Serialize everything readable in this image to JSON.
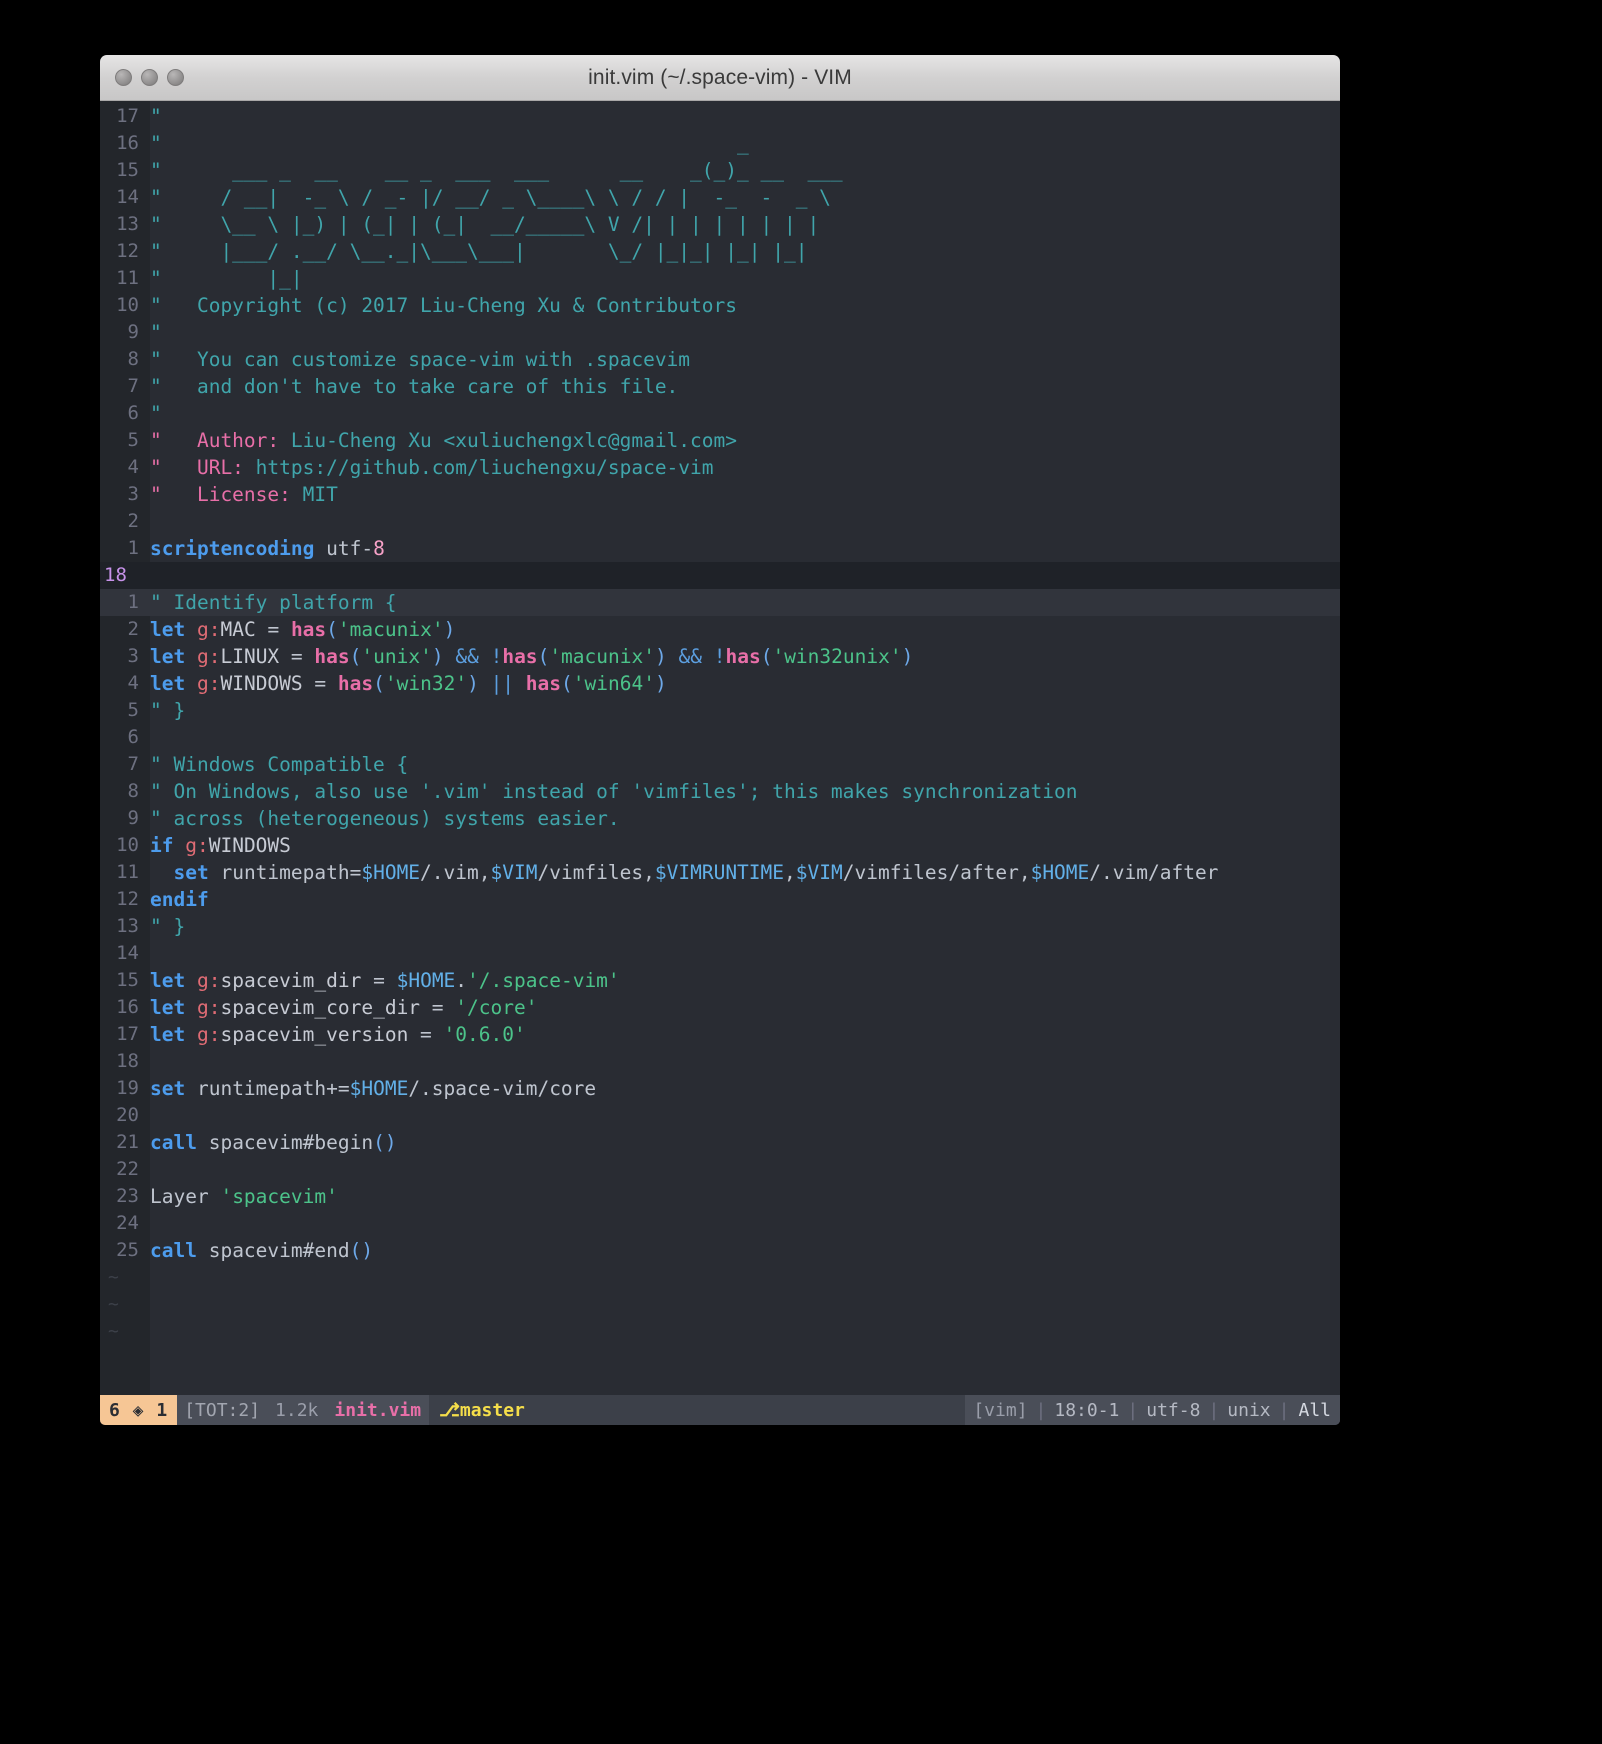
{
  "window": {
    "title": "init.vim (~/.space-vim) - VIM",
    "traffic_lights": [
      "close-button",
      "minimize-button",
      "maximize-button"
    ]
  },
  "theme": {
    "background": "#292c33",
    "gutter_background": "#23262b",
    "cursorline": "#31343c",
    "comment": "#40a5ab",
    "comment_keyword": "#e86fa8",
    "keyword": "#4d9ced",
    "function": "#e86fa8",
    "string": "#4cc38a",
    "number": "#f7a2c8",
    "variable": "#e06c75",
    "mode_accent": "#f6c695",
    "branch_accent": "#f5de4a",
    "cursor_number": "#c792ea"
  },
  "buffer_above": {
    "numbers": [
      "17",
      "16",
      "15",
      "14",
      "13",
      "12",
      "11",
      "10",
      "9",
      "8",
      "7",
      "6",
      "5",
      "4",
      "3",
      "2",
      "1"
    ],
    "lines": [
      {
        "n": "17",
        "tokens": [
          {
            "t": "\"",
            "c": "cmt"
          }
        ]
      },
      {
        "n": "16",
        "tokens": [
          {
            "t": "\"                                                    _",
            "c": "cmt"
          }
        ]
      },
      {
        "n": "15",
        "tokens": [
          {
            "t": "\"       ___ _  __    __ _  ___  ___      __    _(_)_ __  ___",
            "c": "cmt"
          }
        ]
      },
      {
        "n": "14",
        "tokens": [
          {
            "t": "\"      / __| -_ \\ / _- |/ __/ _ \\___\\ \\ / / | -_ - _ \\",
            "c": "cmt"
          }
        ]
      },
      {
        "n": "13",
        "tokens": [
          {
            "t": "\"      \\__ \\ |_) | (_| | (_|  __/____\\ V /| | | | | | | |",
            "c": "cmt"
          }
        ]
      },
      {
        "n": "12",
        "tokens": [
          {
            "t": "\"      |___/ .__/ \\__._|\\___\\___|      \\_/ |_|_| |_| |_|",
            "c": "cmt"
          }
        ]
      },
      {
        "n": "11",
        "tokens": [
          {
            "t": "\"          |_|",
            "c": "cmt"
          }
        ]
      },
      {
        "n": "10",
        "tokens": [
          {
            "t": "\"",
            "c": "cmt"
          }
        ]
      },
      {
        "n": "9",
        "tokens": [
          {
            "t": "\"   Copyright (c) 2017 Liu-Cheng Xu & Contributors",
            "c": "cmt"
          }
        ]
      },
      {
        "n": "8",
        "tokens": [
          {
            "t": "\"",
            "c": "cmt"
          }
        ]
      },
      {
        "n": "7",
        "tokens": [
          {
            "t": "\"   You can customize space-vim with .spacevim",
            "c": "cmt"
          }
        ]
      },
      {
        "n": "6",
        "tokens": [
          {
            "t": "\"   and don't have to take care of this file.",
            "c": "cmt"
          }
        ]
      }
    ]
  },
  "ascii_art": {
    "rows": [
      "\"                                                 _",
      "\"      ___ _  __    __ _  ___  ___      __    _(_)_ __  ___",
      "\"     / __|  -_ \\ / _- |/ __/ _ \\____\\ \\ / / |  -_  -  _ \\",
      "\"     \\__ \\ |_) | (_| | (_|  __/_____\\ V /| | | | | | | |",
      "\"     |___/ .__/ \\__._|\\___\\___|       \\_/ |_|_| |_| |_|",
      "\"         |_|"
    ]
  },
  "header_comments": {
    "copyright": "\"   Copyright (c) 2017 Liu-Cheng Xu & Contributors",
    "customize_1": "\"   You can customize space-vim with .spacevim",
    "customize_2": "\"   and don't have to take care of this file.",
    "author_label": "\"   Author:",
    "author_value": " Liu-Cheng Xu <xuliuchengxlc@gmail.com>",
    "url_label": "\"   URL:",
    "url_value": " https://github.com/liuchengxu/space-vim",
    "license_label": "\"   License:",
    "license_value": " MIT"
  },
  "code": {
    "scriptencoding_kw": "scriptencoding",
    "scriptencoding_val": " utf-",
    "scriptencoding_num": "8",
    "buffer_separator_number": "18",
    "lines": [
      {
        "n": "1",
        "text": "\" Identify platform {"
      },
      {
        "n": "2",
        "text": "let g:MAC = has('macunix')"
      },
      {
        "n": "3",
        "text": "let g:LINUX = has('unix') && !has('macunix') && !has('win32unix')"
      },
      {
        "n": "4",
        "text": "let g:WINDOWS = has('win32') || has('win64')"
      },
      {
        "n": "5",
        "text": "\" }"
      },
      {
        "n": "6",
        "text": ""
      },
      {
        "n": "7",
        "text": "\" Windows Compatible {"
      },
      {
        "n": "8",
        "text": "\" On Windows, also use '.vim' instead of 'vimfiles'; this makes synchronization"
      },
      {
        "n": "9",
        "text": "\" across (heterogeneous) systems easier."
      },
      {
        "n": "10",
        "text": "if g:WINDOWS"
      },
      {
        "n": "11",
        "text": "  set runtimepath=$HOME/.vim,$VIM/vimfiles,$VIMRUNTIME,$VIM/vimfiles/after,$HOME/.vim/after"
      },
      {
        "n": "12",
        "text": "endif"
      },
      {
        "n": "13",
        "text": "\" }"
      },
      {
        "n": "14",
        "text": ""
      },
      {
        "n": "15",
        "text": "let g:spacevim_dir = $HOME.'/.space-vim'"
      },
      {
        "n": "16",
        "text": "let g:spacevim_core_dir = '/core'"
      },
      {
        "n": "17",
        "text": "let g:spacevim_version = '0.6.0'"
      },
      {
        "n": "18",
        "text": ""
      },
      {
        "n": "19",
        "text": "set runtimepath+=$HOME/.space-vim/core"
      },
      {
        "n": "20",
        "text": ""
      },
      {
        "n": "21",
        "text": "call spacevim#begin()"
      },
      {
        "n": "22",
        "text": ""
      },
      {
        "n": "23",
        "text": "Layer 'spacevim'"
      },
      {
        "n": "24",
        "text": ""
      },
      {
        "n": "25",
        "text": "call spacevim#end()"
      }
    ],
    "empty_markers": [
      "~",
      "~",
      "~"
    ]
  },
  "statusline": {
    "mode": "6 ◈ 1",
    "total": "[TOT:2]",
    "filesize": "1.2k",
    "filename": "init.vim",
    "branch_icon": "⎇",
    "branch": "master",
    "filetype": "[vim]",
    "position": "18:0-1",
    "encoding": "utf-8",
    "fileformat": "unix",
    "scroll": "All",
    "divider": "|"
  }
}
